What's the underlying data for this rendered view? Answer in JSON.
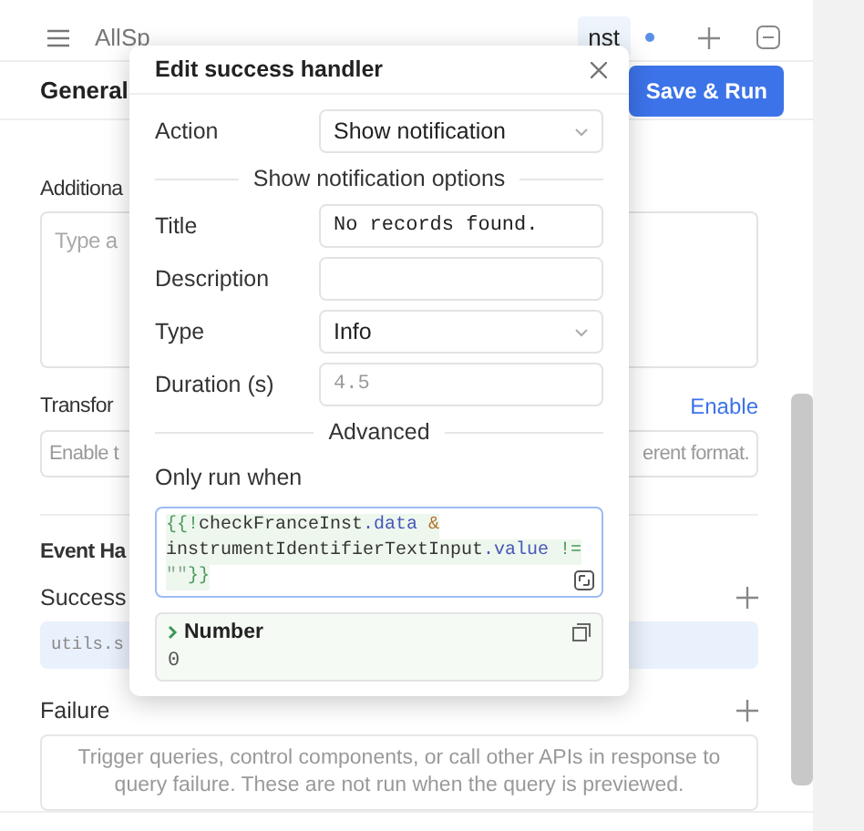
{
  "tab_bar": {
    "tabs": [
      {
        "label": "AllSp",
        "selected": false,
        "unsaved": false
      },
      {
        "label": "nst",
        "selected": true,
        "unsaved": true
      }
    ]
  },
  "header": {
    "title": "General",
    "button": "Save & Run"
  },
  "panel": {
    "additional_label": "Additiona",
    "additional_placeholder": "Type a",
    "transformer_label": "Transfor",
    "transformer_link": "Enable",
    "transformer_input": [
      "Enable t",
      "erent format."
    ],
    "event_label": "Event Ha",
    "handlers": [
      {
        "label": "Success",
        "kind": "item",
        "content": "utils.s"
      },
      {
        "label": "Failure",
        "kind": "empty",
        "content": "Trigger queries, control components, or call other APIs in response to query failure. These are not run when the query is previewed."
      }
    ]
  },
  "modal": {
    "title": "Edit success handler",
    "fields": [
      {
        "kind": "select",
        "label": "Action",
        "value": "Show notification"
      },
      {
        "kind": "section",
        "label": "Show notification options"
      },
      {
        "kind": "input",
        "label": "Title",
        "value": "No records found."
      },
      {
        "kind": "input",
        "label": "Description"
      },
      {
        "kind": "select",
        "label": "Type",
        "value": "Info"
      },
      {
        "kind": "input",
        "label": "Duration (s)",
        "placeholder": "4.5"
      },
      {
        "kind": "section",
        "label": "Advanced"
      }
    ],
    "condition": {
      "label": "Only run when",
      "code": [
        [
          {
            "text": "{{!",
            "kind": "brace"
          },
          {
            "text": "checkFranceInst",
            "kind": "ident"
          },
          {
            "text": ".data",
            "kind": "prop"
          },
          {
            "text": " &",
            "kind": "op"
          }
        ],
        [
          {
            "text": "instrumentIdentifierTextInput",
            "kind": "ident"
          },
          {
            "text": ".value",
            "kind": "prop"
          },
          {
            "text": " !=",
            "kind": "cmp"
          }
        ],
        [
          {
            "text": "\"\"",
            "kind": "string"
          },
          {
            "text": "}}",
            "kind": "brace"
          }
        ]
      ],
      "result": {
        "type": "Number",
        "value": "0"
      }
    }
  }
}
